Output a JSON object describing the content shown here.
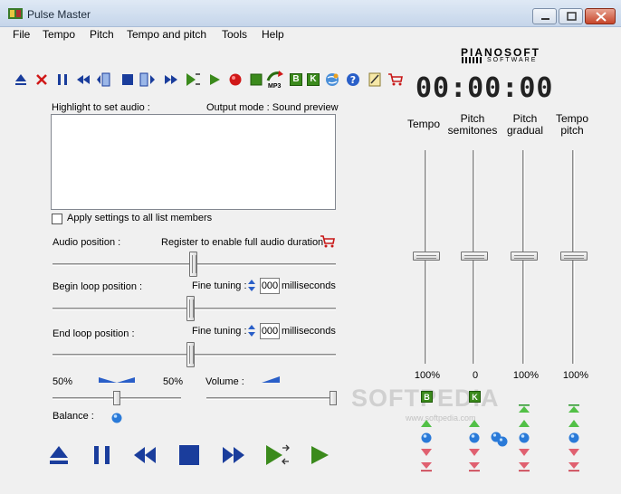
{
  "window": {
    "title": "Pulse Master"
  },
  "menu": [
    "File",
    "Tempo",
    "Pitch",
    "Tempo and pitch",
    "Tools",
    "Help"
  ],
  "toolbar_icons": [
    "eject-icon",
    "delete-icon",
    "pause-icon",
    "rewind-icon",
    "loop-start-icon",
    "stop-icon",
    "loop-end-icon",
    "fast-forward-icon",
    "play-loop-icon",
    "play-icon",
    "record-icon",
    "stop-green-icon",
    "export-mp3-icon",
    "begin-marker-icon",
    "end-marker-icon",
    "web-icon",
    "help-icon",
    "register-icon",
    "cart-icon"
  ],
  "toolbar": {
    "mp3_label": "MP3",
    "b_label": "B",
    "k_label": "K"
  },
  "logo": {
    "main": "PIANOSOFT",
    "sub": "SOFTWARE"
  },
  "timer": "00:00:00",
  "audio_list": {
    "highlight_label": "Highlight to set audio :",
    "output_mode": "Output mode : Sound preview",
    "apply_all_label": "Apply settings to all list members"
  },
  "audio_position": {
    "label": "Audio position :",
    "register_note": "Register to enable full audio duration"
  },
  "begin_loop": {
    "label": "Begin loop position :",
    "fine_label": "Fine tuning :",
    "value": "000",
    "unit": "milliseconds"
  },
  "end_loop": {
    "label": "End loop position :",
    "fine_label": "Fine tuning :",
    "value": "000",
    "unit": "milliseconds"
  },
  "balance": {
    "label": "Balance :",
    "left": "50%",
    "right": "50%"
  },
  "volume": {
    "label": "Volume :"
  },
  "columns": [
    {
      "name": "Tempo",
      "value": "100%"
    },
    {
      "name": "Pitch\nsemitones",
      "value": "0"
    },
    {
      "name": "Pitch\ngradual",
      "value": "100%"
    },
    {
      "name": "Tempo\npitch",
      "value": "100%"
    }
  ],
  "watermark": {
    "main": "SOFTPEDIA",
    "sub": "www.softpedia.com"
  },
  "colors": {
    "accent_blue": "#1a3d9c",
    "green": "#3b8a1c",
    "red": "#d01818"
  }
}
